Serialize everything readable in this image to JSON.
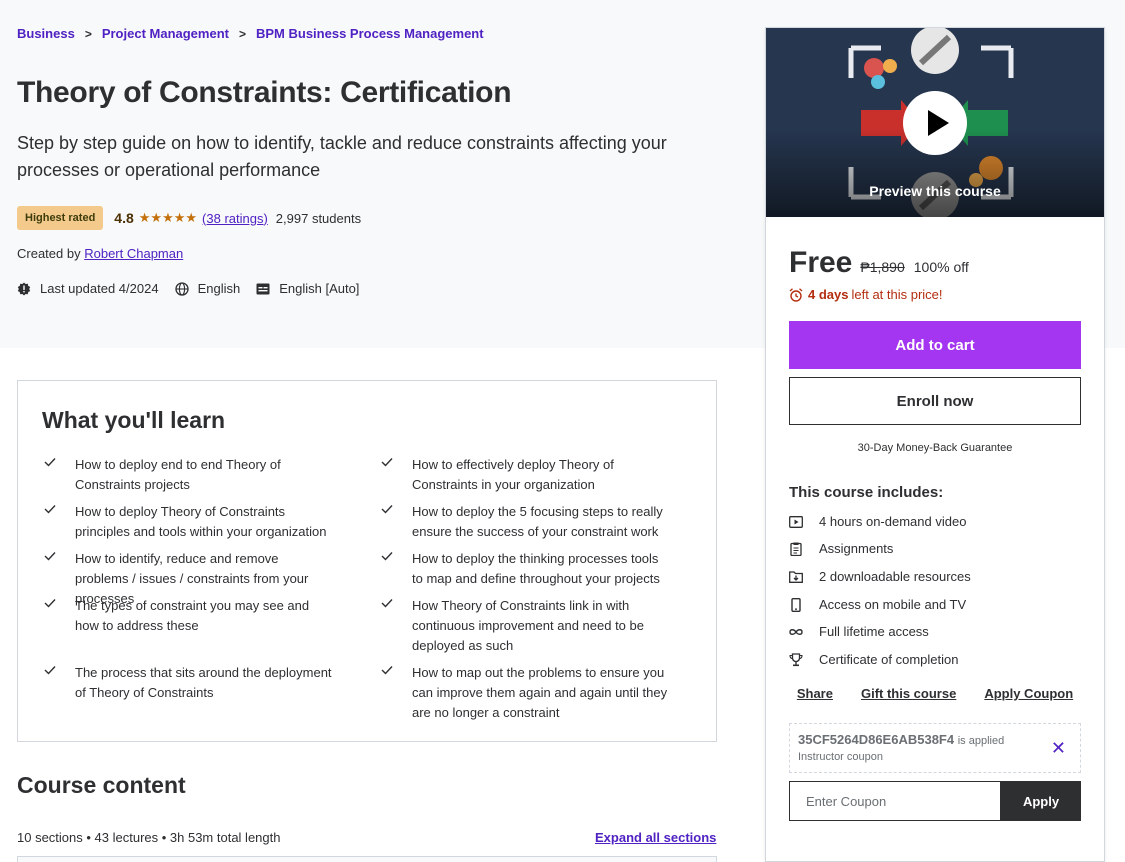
{
  "breadcrumb": [
    "Business",
    "Project Management",
    "BPM Business Process Management"
  ],
  "course": {
    "title": "Theory of Constraints: Certification",
    "subtitle": "Step by step guide on how to identify, tackle and reduce constraints affecting your processes or operational performance",
    "badge": "Highest rated",
    "rating": "4.8",
    "stars": "★★★★★",
    "ratings_link": "(38 ratings)",
    "students": "2,997 students",
    "created_by_label": "Created by",
    "instructor": "Robert Chapman",
    "last_updated": "Last updated 4/2024",
    "language": "English",
    "captions": "English [Auto]"
  },
  "learn": {
    "title": "What you'll learn",
    "items": [
      "How to deploy end to end Theory of Constraints projects",
      "How to effectively deploy Theory of Constraints in your organization",
      "How to deploy Theory of Constraints principles and tools within your organization",
      "How to deploy the 5 focusing steps to really ensure the success of your constraint work",
      "How to identify, reduce and remove problems / issues / constraints from your processes",
      "How to deploy the thinking processes tools to map and define throughout your projects",
      "The types of constraint you may see and how to address these",
      "How Theory of Constraints link in with continuous improvement and need to be deployed as such",
      "The process that sits around the deployment of Theory of Constraints",
      "How to map out the problems to ensure you can improve them again and again until they are no longer a constraint"
    ]
  },
  "content": {
    "title": "Course content",
    "meta": "10 sections • 43 lectures • 3h 53m total length",
    "expand": "Expand all sections"
  },
  "sidebar": {
    "preview_label": "Preview this course",
    "price": "Free",
    "original_price": "₱1,890",
    "discount": "100% off",
    "days_bold": "4 days",
    "days_rest": "left at this price!",
    "add_to_cart": "Add to cart",
    "enroll": "Enroll now",
    "guarantee": "30-Day Money-Back Guarantee",
    "includes_title": "This course includes:",
    "includes": [
      {
        "icon": "video-icon",
        "label": "4 hours on-demand video"
      },
      {
        "icon": "assignment-icon",
        "label": "Assignments"
      },
      {
        "icon": "download-folder-icon",
        "label": "2 downloadable resources"
      },
      {
        "icon": "mobile-icon",
        "label": "Access on mobile and TV"
      },
      {
        "icon": "infinity-icon",
        "label": "Full lifetime access"
      },
      {
        "icon": "trophy-icon",
        "label": "Certificate of completion"
      }
    ],
    "actions": [
      "Share",
      "Gift this course",
      "Apply Coupon"
    ],
    "coupon_code": "35CF5264D86E6AB538F4",
    "coupon_applied": "is applied",
    "coupon_type": "Instructor coupon",
    "coupon_placeholder": "Enter Coupon",
    "apply": "Apply"
  },
  "colors": {
    "brand_purple": "#a435f0",
    "link_purple": "#5022c3",
    "star": "#c4710d",
    "badge_bg": "#f3ca8c",
    "urgent_red": "#b32d0f"
  }
}
